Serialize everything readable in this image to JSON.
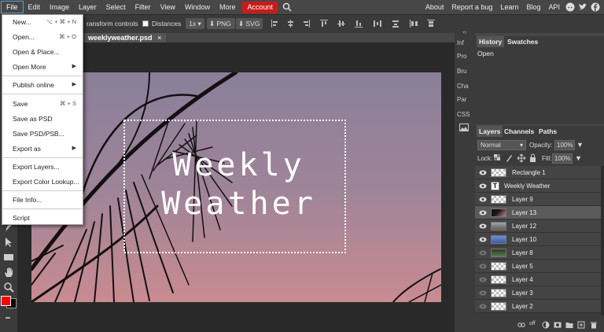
{
  "menubar": {
    "items": [
      "File",
      "Edit",
      "Image",
      "Layer",
      "Select",
      "Filter",
      "View",
      "Window",
      "More"
    ],
    "account": "Account",
    "right_links": [
      "About",
      "Report a bug",
      "Learn",
      "Blog",
      "API"
    ]
  },
  "options_bar": {
    "transform_controls": "ransform controls",
    "distances": "Distances",
    "zoom": "1x",
    "png": "PNG",
    "svg": "SVG"
  },
  "document_tab": {
    "name": "weeklyweather.psd",
    "close": "×"
  },
  "canvas": {
    "line1": "Weekly",
    "line2": "Weather"
  },
  "file_menu": {
    "items": [
      {
        "label": "New...",
        "shortcut": "⌥ + ⌘ + N"
      },
      {
        "label": "Open...",
        "shortcut": "⌘ + O"
      },
      {
        "label": "Open & Place...",
        "shortcut": ""
      },
      {
        "label": "Open More",
        "arrow": "▶"
      },
      {
        "label": "Publish online",
        "arrow": "▶"
      },
      {
        "label": "Save",
        "shortcut": "⌘ + S"
      },
      {
        "label": "Save as PSD",
        "shortcut": ""
      },
      {
        "label": "Save PSD/PSB...",
        "shortcut": ""
      },
      {
        "label": "Export as",
        "arrow": "▶"
      },
      {
        "label": "Export Layers...",
        "shortcut": ""
      },
      {
        "label": "Export Color Lookup...",
        "shortcut": ""
      },
      {
        "label": "File Info...",
        "shortcut": ""
      },
      {
        "label": "Script",
        "shortcut": ""
      }
    ]
  },
  "mini_panel": [
    "Inf",
    "Pro",
    "Bru",
    "Cha",
    "Par",
    "CSS"
  ],
  "history_panel": {
    "tabs": [
      "History",
      "Swatches"
    ],
    "entries": [
      "Open"
    ]
  },
  "layers_panel": {
    "tabs": [
      "Layers",
      "Channels",
      "Paths"
    ],
    "blend_mode": "Normal",
    "opacity_label": "Opacity:",
    "opacity_value": "100%",
    "lock_label": "Lock:",
    "fill_label": "Fill:",
    "fill_value": "100%",
    "layers": [
      {
        "name": "Rectangle 1",
        "visible": true
      },
      {
        "name": "Weekly Weather",
        "visible": true,
        "text": "T"
      },
      {
        "name": "Layer 9",
        "visible": true
      },
      {
        "name": "Layer 13",
        "visible": true,
        "selected": true
      },
      {
        "name": "Layer 12",
        "visible": true
      },
      {
        "name": "Layer 10",
        "visible": true
      },
      {
        "name": "Layer 8",
        "visible": false
      },
      {
        "name": "Layer 5",
        "visible": false
      },
      {
        "name": "Layer 4",
        "visible": false
      },
      {
        "name": "Layer 3",
        "visible": false
      },
      {
        "name": "Layer 2",
        "visible": false
      }
    ],
    "footer_off": "off"
  },
  "colors": {
    "foreground": "#ff0000",
    "background": "#000000",
    "accent": "#c61c1c"
  }
}
